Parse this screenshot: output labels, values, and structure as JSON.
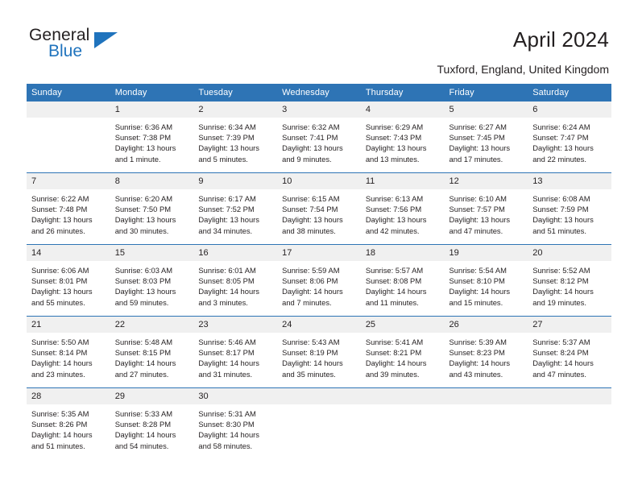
{
  "brand": {
    "name_top": "General",
    "name_bottom": "Blue",
    "triangle_color": "#1f73bd",
    "text_color": "#231f20"
  },
  "header": {
    "title": "April 2024",
    "subtitle": "Tuxford, England, United Kingdom"
  },
  "theme": {
    "header_blue": "#2e74b5",
    "daynum_gray": "#f0f0f0",
    "text": "#231f20"
  },
  "weekdays": [
    "Sunday",
    "Monday",
    "Tuesday",
    "Wednesday",
    "Thursday",
    "Friday",
    "Saturday"
  ],
  "labels": {
    "sunrise": "Sunrise:",
    "sunset": "Sunset:",
    "daylight": "Daylight:"
  },
  "weeks": [
    [
      {
        "day": "",
        "lines": []
      },
      {
        "day": "1",
        "lines": [
          "Sunrise: 6:36 AM",
          "Sunset: 7:38 PM",
          "Daylight: 13 hours",
          "and 1 minute."
        ]
      },
      {
        "day": "2",
        "lines": [
          "Sunrise: 6:34 AM",
          "Sunset: 7:39 PM",
          "Daylight: 13 hours",
          "and 5 minutes."
        ]
      },
      {
        "day": "3",
        "lines": [
          "Sunrise: 6:32 AM",
          "Sunset: 7:41 PM",
          "Daylight: 13 hours",
          "and 9 minutes."
        ]
      },
      {
        "day": "4",
        "lines": [
          "Sunrise: 6:29 AM",
          "Sunset: 7:43 PM",
          "Daylight: 13 hours",
          "and 13 minutes."
        ]
      },
      {
        "day": "5",
        "lines": [
          "Sunrise: 6:27 AM",
          "Sunset: 7:45 PM",
          "Daylight: 13 hours",
          "and 17 minutes."
        ]
      },
      {
        "day": "6",
        "lines": [
          "Sunrise: 6:24 AM",
          "Sunset: 7:47 PM",
          "Daylight: 13 hours",
          "and 22 minutes."
        ]
      }
    ],
    [
      {
        "day": "7",
        "lines": [
          "Sunrise: 6:22 AM",
          "Sunset: 7:48 PM",
          "Daylight: 13 hours",
          "and 26 minutes."
        ]
      },
      {
        "day": "8",
        "lines": [
          "Sunrise: 6:20 AM",
          "Sunset: 7:50 PM",
          "Daylight: 13 hours",
          "and 30 minutes."
        ]
      },
      {
        "day": "9",
        "lines": [
          "Sunrise: 6:17 AM",
          "Sunset: 7:52 PM",
          "Daylight: 13 hours",
          "and 34 minutes."
        ]
      },
      {
        "day": "10",
        "lines": [
          "Sunrise: 6:15 AM",
          "Sunset: 7:54 PM",
          "Daylight: 13 hours",
          "and 38 minutes."
        ]
      },
      {
        "day": "11",
        "lines": [
          "Sunrise: 6:13 AM",
          "Sunset: 7:56 PM",
          "Daylight: 13 hours",
          "and 42 minutes."
        ]
      },
      {
        "day": "12",
        "lines": [
          "Sunrise: 6:10 AM",
          "Sunset: 7:57 PM",
          "Daylight: 13 hours",
          "and 47 minutes."
        ]
      },
      {
        "day": "13",
        "lines": [
          "Sunrise: 6:08 AM",
          "Sunset: 7:59 PM",
          "Daylight: 13 hours",
          "and 51 minutes."
        ]
      }
    ],
    [
      {
        "day": "14",
        "lines": [
          "Sunrise: 6:06 AM",
          "Sunset: 8:01 PM",
          "Daylight: 13 hours",
          "and 55 minutes."
        ]
      },
      {
        "day": "15",
        "lines": [
          "Sunrise: 6:03 AM",
          "Sunset: 8:03 PM",
          "Daylight: 13 hours",
          "and 59 minutes."
        ]
      },
      {
        "day": "16",
        "lines": [
          "Sunrise: 6:01 AM",
          "Sunset: 8:05 PM",
          "Daylight: 14 hours",
          "and 3 minutes."
        ]
      },
      {
        "day": "17",
        "lines": [
          "Sunrise: 5:59 AM",
          "Sunset: 8:06 PM",
          "Daylight: 14 hours",
          "and 7 minutes."
        ]
      },
      {
        "day": "18",
        "lines": [
          "Sunrise: 5:57 AM",
          "Sunset: 8:08 PM",
          "Daylight: 14 hours",
          "and 11 minutes."
        ]
      },
      {
        "day": "19",
        "lines": [
          "Sunrise: 5:54 AM",
          "Sunset: 8:10 PM",
          "Daylight: 14 hours",
          "and 15 minutes."
        ]
      },
      {
        "day": "20",
        "lines": [
          "Sunrise: 5:52 AM",
          "Sunset: 8:12 PM",
          "Daylight: 14 hours",
          "and 19 minutes."
        ]
      }
    ],
    [
      {
        "day": "21",
        "lines": [
          "Sunrise: 5:50 AM",
          "Sunset: 8:14 PM",
          "Daylight: 14 hours",
          "and 23 minutes."
        ]
      },
      {
        "day": "22",
        "lines": [
          "Sunrise: 5:48 AM",
          "Sunset: 8:15 PM",
          "Daylight: 14 hours",
          "and 27 minutes."
        ]
      },
      {
        "day": "23",
        "lines": [
          "Sunrise: 5:46 AM",
          "Sunset: 8:17 PM",
          "Daylight: 14 hours",
          "and 31 minutes."
        ]
      },
      {
        "day": "24",
        "lines": [
          "Sunrise: 5:43 AM",
          "Sunset: 8:19 PM",
          "Daylight: 14 hours",
          "and 35 minutes."
        ]
      },
      {
        "day": "25",
        "lines": [
          "Sunrise: 5:41 AM",
          "Sunset: 8:21 PM",
          "Daylight: 14 hours",
          "and 39 minutes."
        ]
      },
      {
        "day": "26",
        "lines": [
          "Sunrise: 5:39 AM",
          "Sunset: 8:23 PM",
          "Daylight: 14 hours",
          "and 43 minutes."
        ]
      },
      {
        "day": "27",
        "lines": [
          "Sunrise: 5:37 AM",
          "Sunset: 8:24 PM",
          "Daylight: 14 hours",
          "and 47 minutes."
        ]
      }
    ],
    [
      {
        "day": "28",
        "lines": [
          "Sunrise: 5:35 AM",
          "Sunset: 8:26 PM",
          "Daylight: 14 hours",
          "and 51 minutes."
        ]
      },
      {
        "day": "29",
        "lines": [
          "Sunrise: 5:33 AM",
          "Sunset: 8:28 PM",
          "Daylight: 14 hours",
          "and 54 minutes."
        ]
      },
      {
        "day": "30",
        "lines": [
          "Sunrise: 5:31 AM",
          "Sunset: 8:30 PM",
          "Daylight: 14 hours",
          "and 58 minutes."
        ]
      },
      {
        "day": "",
        "lines": []
      },
      {
        "day": "",
        "lines": []
      },
      {
        "day": "",
        "lines": []
      },
      {
        "day": "",
        "lines": []
      }
    ]
  ]
}
